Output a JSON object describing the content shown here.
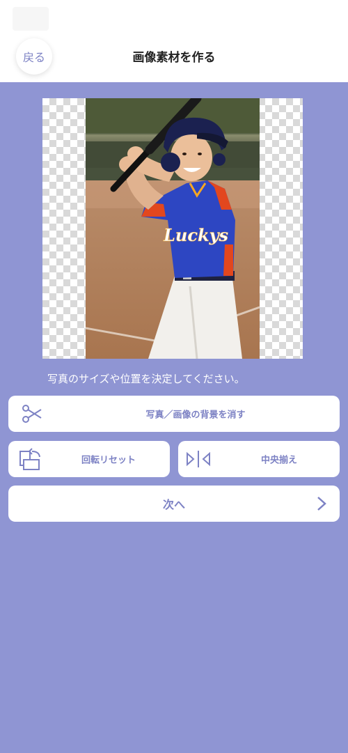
{
  "header": {
    "back_label": "戻る",
    "title": "画像素材を作る"
  },
  "instruction": "写真のサイズや位置を決定してください。",
  "buttons": {
    "remove_background": "写真／画像の背景を消す",
    "rotate_reset": "回転リセット",
    "center_align": "中央揃え",
    "next": "次へ"
  },
  "photo": {
    "jersey_text": "Luckys"
  },
  "colors": {
    "background": "#8f95d3",
    "accent": "#7d82c4"
  }
}
